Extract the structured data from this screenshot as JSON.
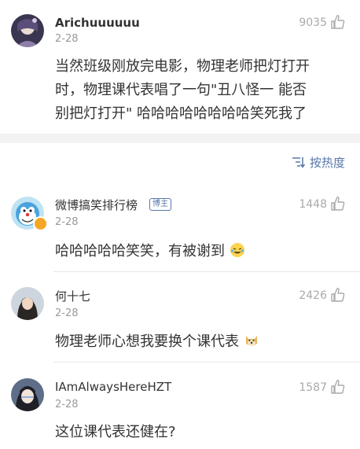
{
  "post": {
    "username": "Arichuuuuuu",
    "date": "2-28",
    "likes": "9035",
    "text_lines": [
      "当然班级刚放完电影，物理老师把灯打开",
      "时，物理课代表唱了一句\"丑八怪一 能否",
      "别把灯打开\" 哈哈哈哈哈哈哈哈笑死我了"
    ]
  },
  "sort": {
    "label": "按热度",
    "icon": "sort-icon"
  },
  "comments": [
    {
      "username": "微博搞笑排行榜",
      "badge": "博主",
      "date": "2-28",
      "likes": "1448",
      "text": "哈哈哈哈哈笑笑，有被谢到"
    },
    {
      "username": "何十七",
      "date": "2-28",
      "likes": "2426",
      "text": "物理老师心想我要换个课代表"
    },
    {
      "username": "IAmAlwaysHereHZT",
      "date": "2-28",
      "likes": "1587",
      "text": "这位课代表还健在?"
    }
  ],
  "colors": {
    "accent": "#5877a8",
    "text": "#333333",
    "muted": "#999999",
    "band": "#f2f2f2"
  }
}
